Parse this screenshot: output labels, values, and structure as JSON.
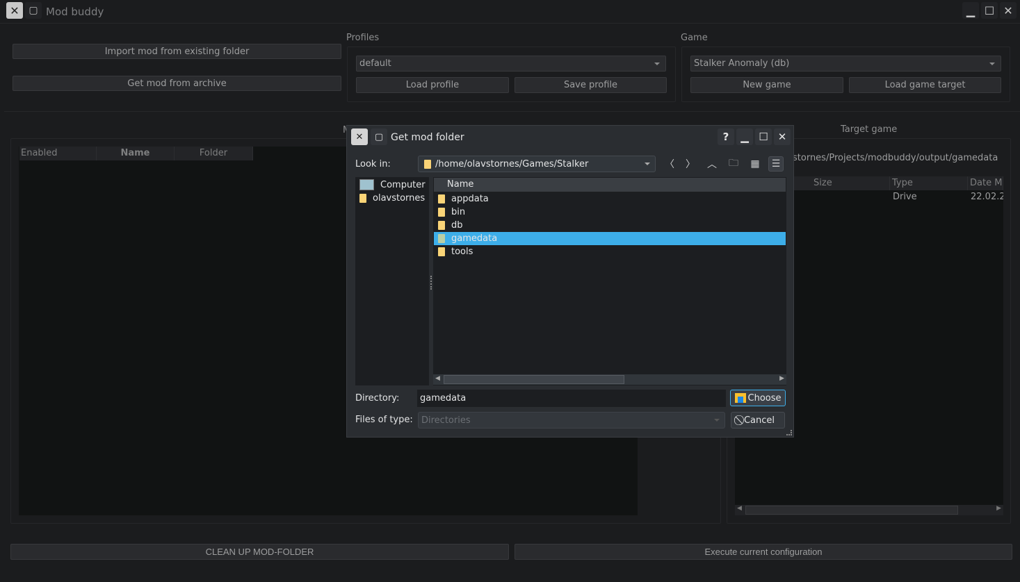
{
  "window": {
    "title": "Mod buddy",
    "minimize_label": "minimize",
    "maximize_label": "maximize",
    "close_label": "close"
  },
  "actions": {
    "import_folder": "Import mod from existing folder",
    "get_archive": "Get mod from archive"
  },
  "profiles": {
    "label": "Profiles",
    "selected": "default",
    "load": "Load profile",
    "save": "Save profile"
  },
  "game": {
    "label": "Game",
    "selected": "Stalker Anomaly (db)",
    "new": "New game",
    "load_target": "Load game target"
  },
  "mods_table": {
    "label_partial": "M",
    "columns": [
      "Enabled",
      "Name",
      "Folder"
    ]
  },
  "target_game": {
    "label": "Target game",
    "path": "stornes/Projects/modbuddy/output/gamedata",
    "columns": [
      "Size",
      "Type",
      "Date Mo"
    ],
    "rows": [
      {
        "size": "",
        "type": "Drive",
        "date": "22.02.2"
      }
    ]
  },
  "footer": {
    "cleanup": "CLEAN UP MOD-FOLDER",
    "execute": "Execute current configuration"
  },
  "dialog": {
    "title": "Get mod folder",
    "help": "?",
    "look_in_label": "Look in:",
    "look_in_path": "/home/olavstornes/Games/Stalker",
    "sidebar": [
      {
        "label": "Computer",
        "icon": "computer-icon"
      },
      {
        "label": "olavstornes",
        "icon": "folder-icon"
      }
    ],
    "file_list_header": "Name",
    "files": [
      {
        "name": "appdata",
        "selected": false
      },
      {
        "name": "bin",
        "selected": false
      },
      {
        "name": "db",
        "selected": false
      },
      {
        "name": "gamedata",
        "selected": true
      },
      {
        "name": "tools",
        "selected": false
      }
    ],
    "directory_label": "Directory:",
    "directory_value": "gamedata",
    "files_of_type_label": "Files of type:",
    "files_of_type_value": "Directories",
    "choose": "Choose",
    "cancel": "Cancel",
    "accent": "#3daee9"
  }
}
